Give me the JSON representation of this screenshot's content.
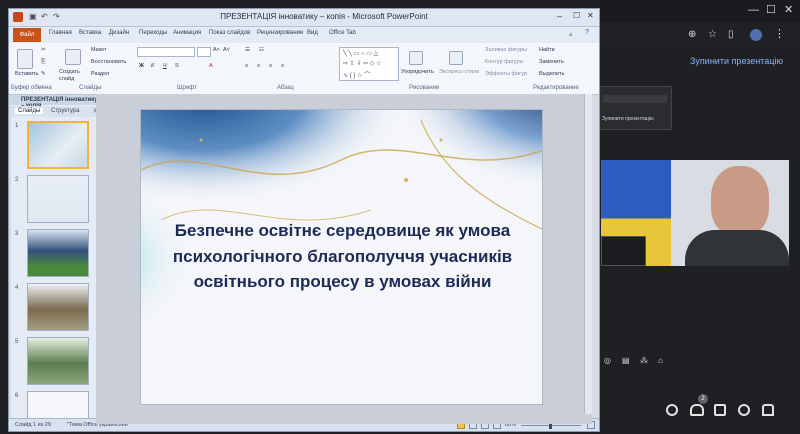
{
  "window": {
    "title": "ПРЕЗЕНТАЦІЯ інноватику – копія - Microsoft PowerPoint"
  },
  "ribbon": {
    "file_tab": "Файл",
    "tabs": [
      "Главная",
      "Вставка",
      "Дизайн",
      "Переходы",
      "Анимация",
      "Показ слайдов",
      "Рецензирование",
      "Вид",
      "Office Tab"
    ],
    "groups": [
      "Буфер обмена",
      "Слайды",
      "Шрифт",
      "Абзац",
      "Рисование",
      "Редактирование"
    ],
    "buttons": {
      "paste": "Вставить",
      "new_slide": "Создать слайд",
      "layout": "Макет",
      "reset": "Восстановить",
      "section": "Раздел",
      "arrange": "Упорядочить",
      "quick_styles": "Экспресс-стили",
      "shape_fill": "Заливка фигуры",
      "shape_outline": "Контур фигуры",
      "shape_effects": "Эффекты фигур",
      "find": "Найти",
      "replace": "Заменить",
      "select": "Выделить"
    }
  },
  "slides_pane": {
    "doc_tab": "ПРЕЗЕНТАЦІЯ інноватику – копія",
    "tabs": [
      "Слайды",
      "Структура"
    ],
    "numbers": [
      "1",
      "2",
      "3",
      "4",
      "5",
      "6"
    ]
  },
  "slide": {
    "title": "Безпечне освітнє середовище як умова психологічного благополуччя учасників освітнього процесу в умовах війни"
  },
  "status_bar": {
    "slide_info": "Слайд 1 из 29",
    "theme": "\"Тема Office\"",
    "language": "украинский",
    "zoom": "60%"
  },
  "meet": {
    "stop_presentation": "Зупинити презентацію",
    "mini_stop": "Зупинити презентацію",
    "participants_count": "2"
  }
}
